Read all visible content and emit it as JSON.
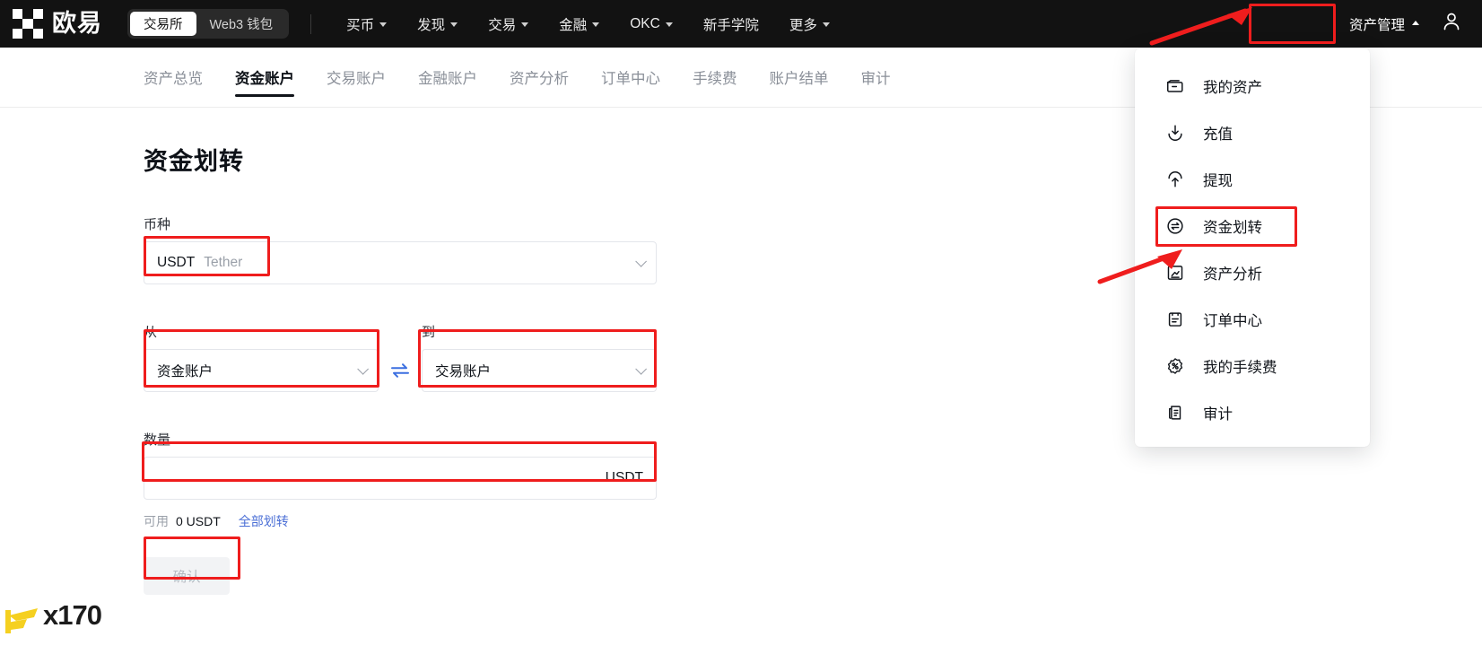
{
  "topbar": {
    "brand_name": "欧易",
    "logo_icon": "okx-logo-icon",
    "segments": [
      {
        "label": "交易所",
        "active": true
      },
      {
        "label": "Web3 钱包",
        "active": false
      }
    ],
    "nav_items": [
      {
        "label": "买币",
        "has_caret": true
      },
      {
        "label": "发现",
        "has_caret": true
      },
      {
        "label": "交易",
        "has_caret": true
      },
      {
        "label": "金融",
        "has_caret": true
      },
      {
        "label": "OKC",
        "has_caret": true
      },
      {
        "label": "新手学院",
        "has_caret": false
      },
      {
        "label": "更多",
        "has_caret": true
      }
    ],
    "asset_mgmt_label": "资产管理",
    "asset_mgmt_caret": "chevron-up-icon",
    "account_icon": "user-avatar-icon"
  },
  "subnav": {
    "tabs": [
      {
        "label": "资产总览",
        "active": false
      },
      {
        "label": "资金账户",
        "active": true
      },
      {
        "label": "交易账户",
        "active": false
      },
      {
        "label": "金融账户",
        "active": false
      },
      {
        "label": "资产分析",
        "active": false
      },
      {
        "label": "订单中心",
        "active": false
      },
      {
        "label": "手续费",
        "active": false
      },
      {
        "label": "账户结单",
        "active": false
      },
      {
        "label": "审计",
        "active": false
      }
    ]
  },
  "form": {
    "title": "资金划转",
    "currency": {
      "label": "币种",
      "value": "USDT",
      "value_sub": "Tether",
      "chevron": "chevron-down-icon"
    },
    "from": {
      "label": "从",
      "value": "资金账户",
      "chevron": "chevron-down-icon"
    },
    "swap_icon": "swap-arrows-icon",
    "to": {
      "label": "到",
      "value": "交易账户",
      "chevron": "chevron-down-icon"
    },
    "amount": {
      "label": "数量",
      "value": "",
      "placeholder": "",
      "unit": "USDT"
    },
    "available": {
      "label": "可用",
      "value": "0 USDT",
      "all_transfer_link": "全部划转"
    },
    "confirm_label": "确认"
  },
  "dropdown": {
    "items": [
      {
        "label": "我的资产",
        "icon": "wallet-icon",
        "highlighted": false
      },
      {
        "label": "充值",
        "icon": "deposit-arrow-down-icon",
        "highlighted": false
      },
      {
        "label": "提现",
        "icon": "withdraw-arrow-up-icon",
        "highlighted": false
      },
      {
        "label": "资金划转",
        "icon": "transfer-circle-icon",
        "highlighted": true
      },
      {
        "label": "资产分析",
        "icon": "analysis-chart-icon",
        "highlighted": false
      },
      {
        "label": "订单中心",
        "icon": "order-clipboard-icon",
        "highlighted": false
      },
      {
        "label": "我的手续费",
        "icon": "fee-badge-percent-icon",
        "highlighted": false
      },
      {
        "label": "审计",
        "icon": "audit-document-icon",
        "highlighted": false
      }
    ]
  },
  "watermark": {
    "text": "x170",
    "mark_icon": "fx-logo-icon"
  },
  "colors": {
    "annotation_red": "#EF1D1D",
    "topbar_bg": "#121212",
    "accent_link": "#4B6FD6",
    "swap_blue": "#3B6FE0",
    "watermark_yellow": "#F5D020"
  }
}
